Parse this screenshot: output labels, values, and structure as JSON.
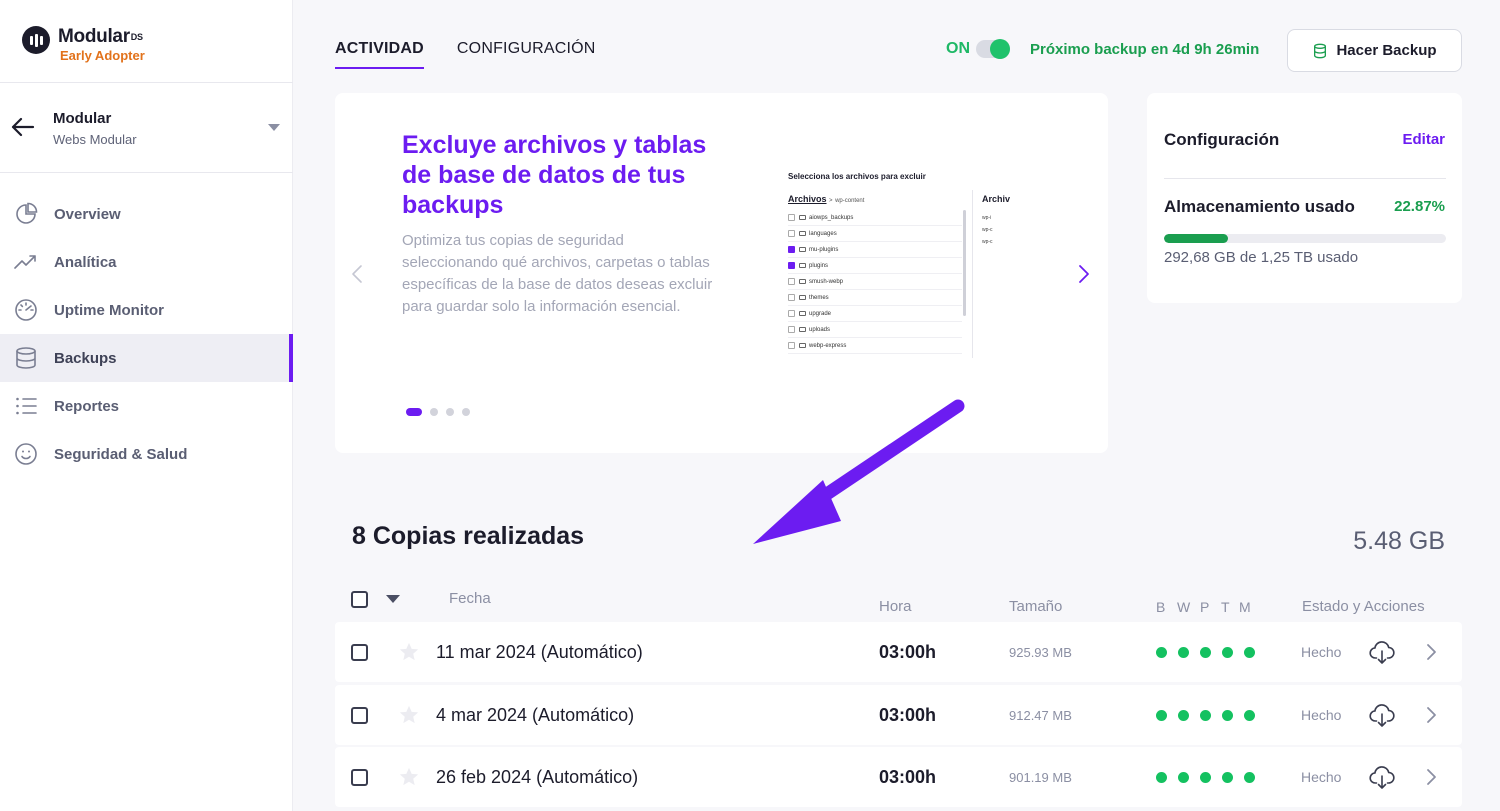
{
  "brand": {
    "name": "Modular",
    "ds": "DS",
    "subtitle": "Early Adopter"
  },
  "site": {
    "name": "Modular",
    "subtitle": "Webs Modular"
  },
  "sidebar": {
    "items": [
      {
        "label": "Overview",
        "icon": "pie-chart-icon"
      },
      {
        "label": "Analítica",
        "icon": "trending-up-icon"
      },
      {
        "label": "Uptime Monitor",
        "icon": "gauge-icon"
      },
      {
        "label": "Backups",
        "icon": "database-icon",
        "active": true
      },
      {
        "label": "Reportes",
        "icon": "list-icon"
      },
      {
        "label": "Seguridad & Salud",
        "icon": "smiley-icon"
      }
    ]
  },
  "header": {
    "tabs": [
      {
        "label": "ACTIVIDAD",
        "active": true
      },
      {
        "label": "CONFIGURACIÓN"
      }
    ],
    "toggle_label": "ON",
    "next_backup": "Próximo backup en 4d 9h 26min",
    "backup_button": "Hacer Backup"
  },
  "carousel": {
    "title": "Excluye archivos y tablas de base de datos de tus backups",
    "text": "Optimiza tus copias de seguridad seleccionando qué archivos, carpetas o tablas específicas de la base de datos deseas excluir para guardar solo la información esencial.",
    "slides": 4,
    "active_slide": 1,
    "preview": {
      "title": "Selecciona los archivos para excluir",
      "crumb_root": "Archivos",
      "crumb_sep": ">",
      "crumb_child": "wp-content",
      "right_title": "Archiv",
      "right_items": [
        "wp-i",
        "wp-c",
        "wp-c"
      ],
      "folders": [
        {
          "name": "aiowps_backups",
          "checked": false
        },
        {
          "name": "languages",
          "checked": false
        },
        {
          "name": "mu-plugins",
          "checked": true
        },
        {
          "name": "plugins",
          "checked": true
        },
        {
          "name": "smush-webp",
          "checked": false
        },
        {
          "name": "themes",
          "checked": false
        },
        {
          "name": "upgrade",
          "checked": false
        },
        {
          "name": "uploads",
          "checked": false
        },
        {
          "name": "webp-express",
          "checked": false
        }
      ]
    }
  },
  "config": {
    "title": "Configuración",
    "edit": "Editar",
    "storage_label": "Almacenamiento usado",
    "storage_pct": "22.87%",
    "storage_fraction": 0.2287,
    "storage_used": "292,68 GB de 1,25 TB usado"
  },
  "list": {
    "title": "8 Copias realizadas",
    "total": "5.48 GB",
    "columns": {
      "date": "Fecha",
      "time": "Hora",
      "size": "Tamaño",
      "letters": [
        "B",
        "W",
        "P",
        "T",
        "M"
      ],
      "status": "Estado y Acciones"
    },
    "rows": [
      {
        "date": "11 mar 2024 (Automático)",
        "time": "03:00h",
        "size": "925.93 MB",
        "status": "Hecho"
      },
      {
        "date": "4 mar 2024 (Automático)",
        "time": "03:00h",
        "size": "912.47 MB",
        "status": "Hecho"
      },
      {
        "date": "26 feb 2024 (Automático)",
        "time": "03:00h",
        "size": "901.19 MB",
        "status": "Hecho"
      }
    ]
  },
  "colors": {
    "accent": "#6c1cf1",
    "success": "#1a9e4f",
    "dot": "#14c160",
    "brand_sub": "#e2721b"
  }
}
